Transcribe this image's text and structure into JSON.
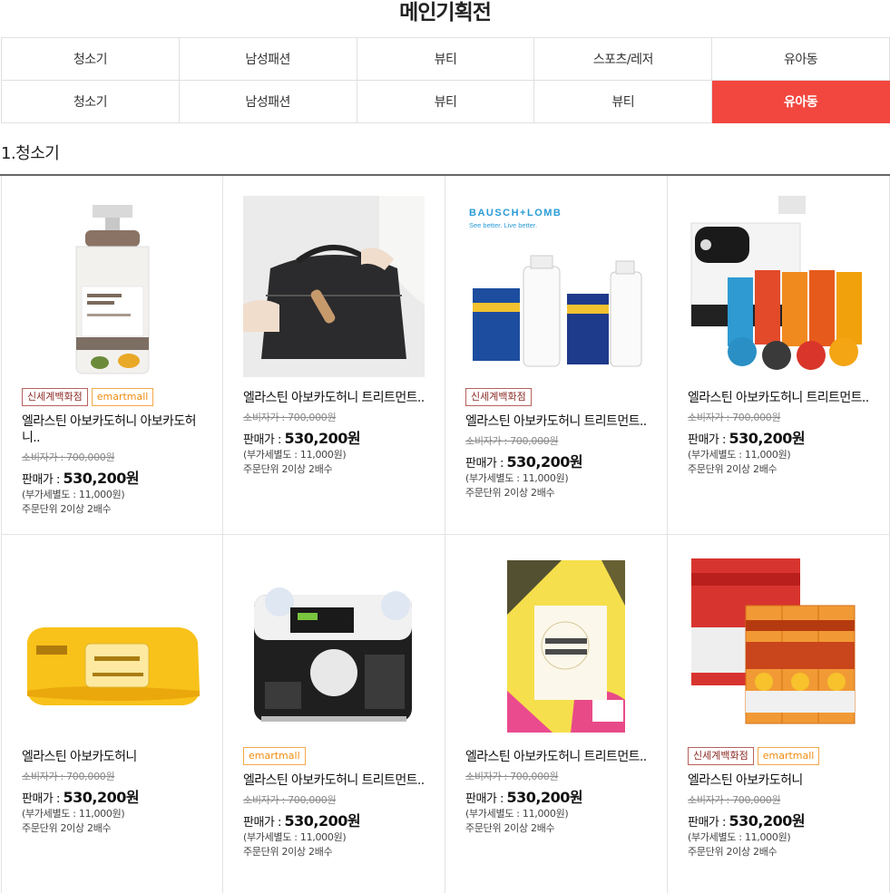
{
  "page_title": "메인기획전",
  "tabs_row1": [
    "청소기",
    "남성패션",
    "뷰티",
    "스포츠/레저",
    "유아동"
  ],
  "tabs_row2": [
    "청소기",
    "남성패션",
    "뷰티",
    "뷰티",
    "유아동"
  ],
  "active_tab": "row2-5",
  "section_title": "1.청소기",
  "colors": {
    "accent": "#f2473f",
    "ssg_badge": "#8b2a25",
    "emart_badge": "#f08c0f"
  },
  "badges": {
    "ssg": "신세계백화점",
    "emart": "emartmall"
  },
  "products": [
    {
      "image": "avocado-honey-treatment-bottle",
      "name": "엘라스틴 아보카도허니 아보카도허니..",
      "orig": "소비자가 : 700,000원",
      "sale_label": "판매가 : ",
      "sale_price": "530,200원",
      "vat": "(부가세별도 : 11,000원)",
      "unit": "주문단위 2이상 2배수"
    },
    {
      "image": "black-pouch-bag",
      "name": "엘라스틴 아보카도허니 트리트먼트..",
      "orig": "소비자가 : 700,000원",
      "sale_label": "판매가 : ",
      "sale_price": "530,200원",
      "vat": "(부가세별도 : 11,000원)",
      "unit": "주문단위 2이상 2배수"
    },
    {
      "image": "bausch-lomb-solution",
      "brand_text": "BAUSCH+LOMB",
      "brand_tagline": "See better. Live better.",
      "name": "엘라스틴 아보카도허니 트리트먼트..",
      "orig": "소비자가 : 700,000원",
      "sale_label": "판매가 : ",
      "sale_price": "530,200원",
      "vat": "(부가세별도 : 11,000원)",
      "unit": "주문단위 2이상 2배수"
    },
    {
      "image": "capsule-coffee-machine",
      "name": "엘라스틴 아보카도허니 트리트먼트..",
      "orig": "소비자가 : 700,000원",
      "sale_label": "판매가 : ",
      "sale_price": "530,200원",
      "vat": "(부가세별도 : 11,000원)",
      "unit": "주문단위 2이상 2배수"
    },
    {
      "image": "wet-tissue-pack",
      "name": "엘라스틴 아보카도허니",
      "orig": "소비자가 : 700,000원",
      "sale_label": "판매가 : ",
      "sale_price": "530,200원",
      "vat": "(부가세별도 : 11,000원)",
      "unit": "주문단위 2이상 2배수"
    },
    {
      "image": "kitchen-towel-pack",
      "name": "엘라스틴 아보카도허니 트리트먼트..",
      "orig": "소비자가 : 700,000원",
      "sale_label": "판매가 : ",
      "sale_price": "530,200원",
      "vat": "(부가세별도 : 11,000원)",
      "unit": "주문단위 2이상 2배수"
    },
    {
      "image": "facial-tissue-box",
      "name": "엘라스틴 아보카도허니 트리트먼트..",
      "orig": "소비자가 : 700,000원",
      "sale_label": "판매가 : ",
      "sale_price": "530,200원",
      "vat": "(부가세별도 : 11,000원)",
      "unit": "주문단위 2이상 2배수"
    },
    {
      "image": "toothpaste-2080-set",
      "name": "엘라스틴 아보카도허니",
      "orig": "소비자가 : 700,000원",
      "sale_label": "판매가 : ",
      "sale_price": "530,200원",
      "vat": "(부가세별도 : 11,000원)",
      "unit": "주문단위 2이상 2배수"
    }
  ]
}
